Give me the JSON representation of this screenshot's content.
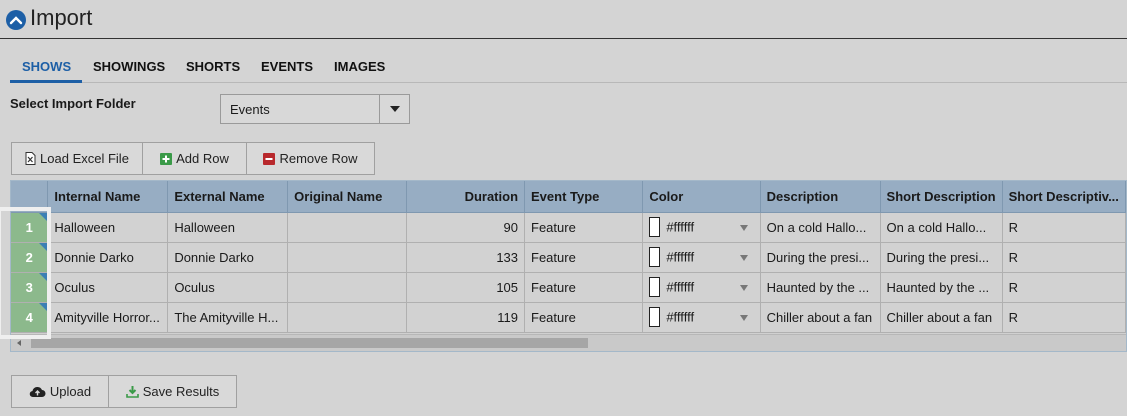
{
  "header": {
    "title": "Import",
    "icon": "chevron-up-circle-icon",
    "accent": "#1d5fa6"
  },
  "tabs": [
    {
      "label": "SHOWS",
      "active": true
    },
    {
      "label": "SHOWINGS",
      "active": false
    },
    {
      "label": "SHORTS",
      "active": false
    },
    {
      "label": "EVENTS",
      "active": false
    },
    {
      "label": "IMAGES",
      "active": false
    }
  ],
  "folder": {
    "label": "Select Import Folder",
    "selected": "Events"
  },
  "toolbar": {
    "load_excel": "Load Excel File",
    "add_row": "Add Row",
    "remove_row": "Remove Row"
  },
  "grid": {
    "columns": [
      "Internal Name",
      "External Name",
      "Original Name",
      "Duration",
      "Event Type",
      "Color",
      "Description",
      "Short Description",
      "Short Descriptiv..."
    ],
    "rows": [
      {
        "num": "1",
        "internal": "Halloween",
        "external": "Halloween",
        "original": "",
        "duration": "90",
        "type": "Feature",
        "color": "#ffffff",
        "desc": "On a cold Hallo...",
        "short": "On a cold Hallo...",
        "short2": "R"
      },
      {
        "num": "2",
        "internal": "Donnie Darko",
        "external": "Donnie Darko",
        "original": "",
        "duration": "133",
        "type": "Feature",
        "color": "#ffffff",
        "desc": "During the presi...",
        "short": "During the presi...",
        "short2": "R"
      },
      {
        "num": "3",
        "internal": "Oculus",
        "external": "Oculus",
        "original": "",
        "duration": "105",
        "type": "Feature",
        "color": "#ffffff",
        "desc": "Haunted by the ...",
        "short": "Haunted by the ...",
        "short2": "R"
      },
      {
        "num": "4",
        "internal": "Amityville Horror...",
        "external": "The Amityville H...",
        "original": "",
        "duration": "119",
        "type": "Feature",
        "color": "#ffffff",
        "desc": "Chiller about a fan",
        "short": "Chiller about a fan",
        "short2": "R"
      }
    ]
  },
  "footer": {
    "upload": "Upload",
    "save_results": "Save Results"
  }
}
